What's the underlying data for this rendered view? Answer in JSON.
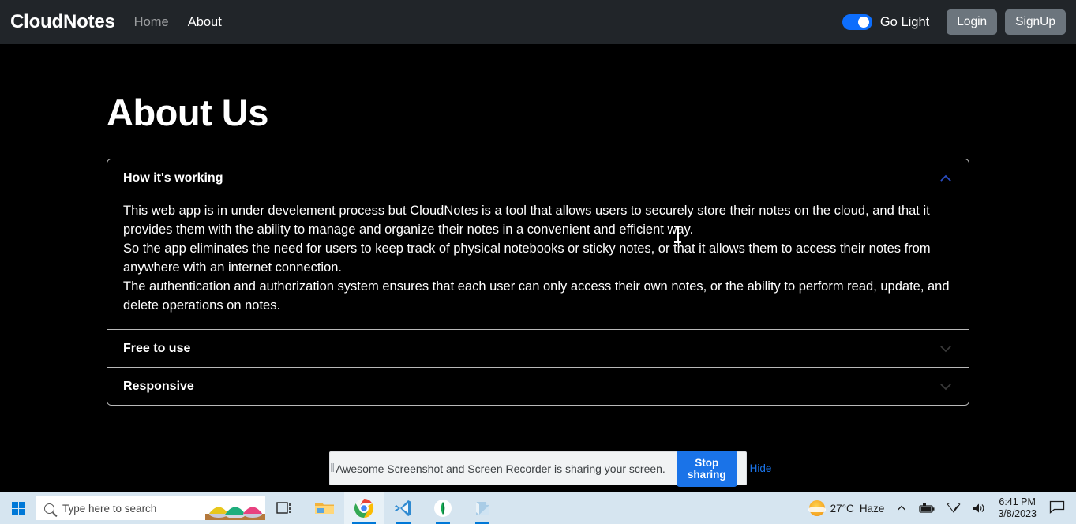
{
  "navbar": {
    "brand": "CloudNotes",
    "links": [
      {
        "label": "Home",
        "active": false
      },
      {
        "label": "About",
        "active": true
      }
    ],
    "theme_toggle": {
      "label": "Go Light",
      "state": "on",
      "color": "#0d6efd"
    },
    "buttons": [
      {
        "label": "Login"
      },
      {
        "label": "SignUp"
      }
    ]
  },
  "page": {
    "title": "About Us"
  },
  "accordion": {
    "items": [
      {
        "title": "How it's working",
        "expanded": true,
        "icon": "chevron-up-icon",
        "body": [
          "This web app is in under develement process but CloudNotes is a tool that allows users to securely store their notes on the cloud, and that it provides them with the ability to manage and organize their notes in a convenient and efficient way.",
          "So the app eliminates the need for users to keep track of physical notebooks or sticky notes, or that it allows them to access their notes from anywhere with an internet connection.",
          "The authentication and authorization system ensures that each user can only access their own notes, or the ability to perform read, update, and delete operations on notes."
        ]
      },
      {
        "title": "Free to use",
        "expanded": false,
        "icon": "chevron-down-icon",
        "body": []
      },
      {
        "title": "Responsive",
        "expanded": false,
        "icon": "chevron-down-icon",
        "body": []
      }
    ]
  },
  "share_bar": {
    "message": "Awesome Screenshot and Screen Recorder is sharing your screen.",
    "stop_label": "Stop sharing",
    "hide_label": "Hide",
    "accent": "#1a73e8"
  },
  "taskbar": {
    "search_placeholder": "Type here to search",
    "apps": [
      {
        "name": "task-view",
        "label": "Task View"
      },
      {
        "name": "file-explorer",
        "label": "File Explorer"
      },
      {
        "name": "google-chrome",
        "label": "Google Chrome"
      },
      {
        "name": "visual-studio-code",
        "label": "Visual Studio Code"
      },
      {
        "name": "mongodb-compass",
        "label": "MongoDB Compass"
      },
      {
        "name": "notepad",
        "label": "Notepad"
      }
    ],
    "tray": {
      "temperature": "27°C",
      "condition": "Haze",
      "time": "6:41 PM",
      "date": "3/8/2023"
    }
  }
}
